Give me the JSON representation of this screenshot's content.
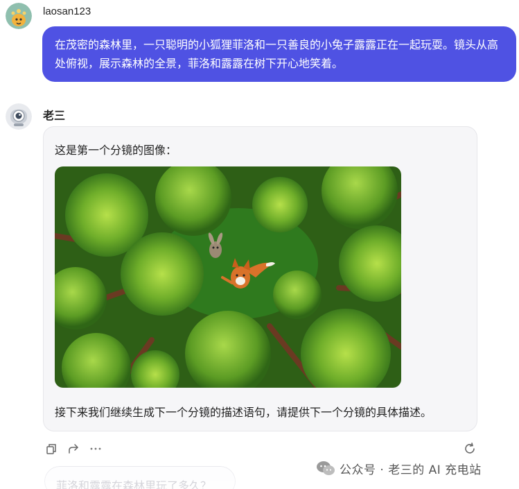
{
  "user": {
    "name": "laosan123",
    "message": "在茂密的森林里，一只聪明的小狐狸菲洛和一只善良的小兔子露露正在一起玩耍。镜头从高处俯视，展示森林的全景，菲洛和露露在树下开心地笑着。"
  },
  "bot": {
    "name": "老三",
    "intro": "这是第一个分镜的图像：",
    "outro": "接下来我们继续生成下一个分镜的描述语句，请提供下一个分镜的具体描述。"
  },
  "actions": [
    "copy-icon",
    "share-icon",
    "more-icon",
    "refresh-icon"
  ],
  "suggestion": "菲洛和露露在森林里玩了多久？",
  "watermark": "公众号 · 老三的 AI 充电站",
  "colors": {
    "user_bubble": "#4f52e3",
    "bot_bubble": "#f6f6f8"
  }
}
